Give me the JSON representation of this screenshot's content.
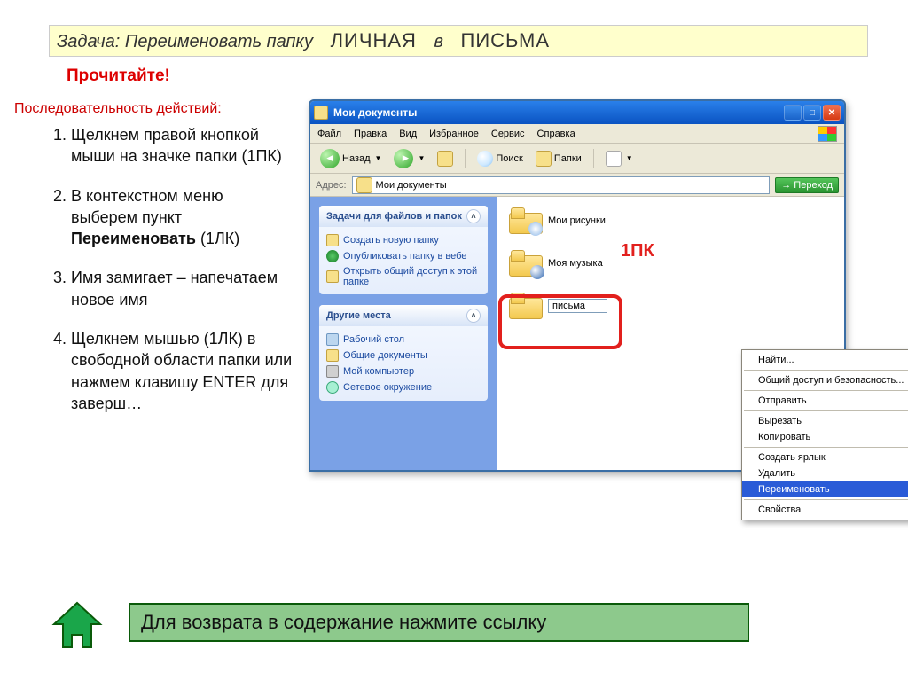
{
  "task": {
    "label": "Задача:",
    "text": "Переименовать папку",
    "from": "ЛИЧНАЯ",
    "mid": "в",
    "to": "ПИСЬМА"
  },
  "read": "Прочитайте!",
  "seq": "Последовательность действий:",
  "steps": {
    "s1": "Щелкнем правой кнопкой мыши на значке папки (1ПК)",
    "s2a": "В контекстном меню выберем пункт ",
    "s2b": "Переименовать",
    "s2c": " (1ЛК)",
    "s3": "Имя замигает – напечатаем новое имя",
    "s4": "Щелкнем мышью (1ЛК) в свободной области папки или нажмем клавишу ENTER для заверш…"
  },
  "explorer": {
    "title": "Мои документы",
    "menu": [
      "Файл",
      "Правка",
      "Вид",
      "Избранное",
      "Сервис",
      "Справка"
    ],
    "toolbar": {
      "back": "Назад",
      "search": "Поиск",
      "folders": "Папки"
    },
    "address": {
      "label": "Адрес:",
      "value": "Мои документы",
      "go": "Переход"
    },
    "panel1": {
      "title": "Задачи для файлов и папок",
      "links": [
        "Создать новую папку",
        "Опубликовать папку в вебе",
        "Открыть общий доступ к этой папке"
      ]
    },
    "panel2": {
      "title": "Другие места",
      "links": [
        "Рабочий стол",
        "Общие документы",
        "Мой компьютер",
        "Сетевое окружение"
      ]
    },
    "items": {
      "pics": "Мои рисунки",
      "music": "Моя музыка",
      "letters": "письма"
    }
  },
  "annot": {
    "rclick": "1ПК"
  },
  "ctx": {
    "find": "Найти...",
    "share": "Общий доступ и безопасность...",
    "send": "Отправить",
    "cut": "Вырезать",
    "copy": "Копировать",
    "shortcut": "Создать ярлык",
    "delete": "Удалить",
    "rename": "Переименовать",
    "props": "Свойства"
  },
  "backlink": "Для возврата в содержание нажмите ссылку"
}
